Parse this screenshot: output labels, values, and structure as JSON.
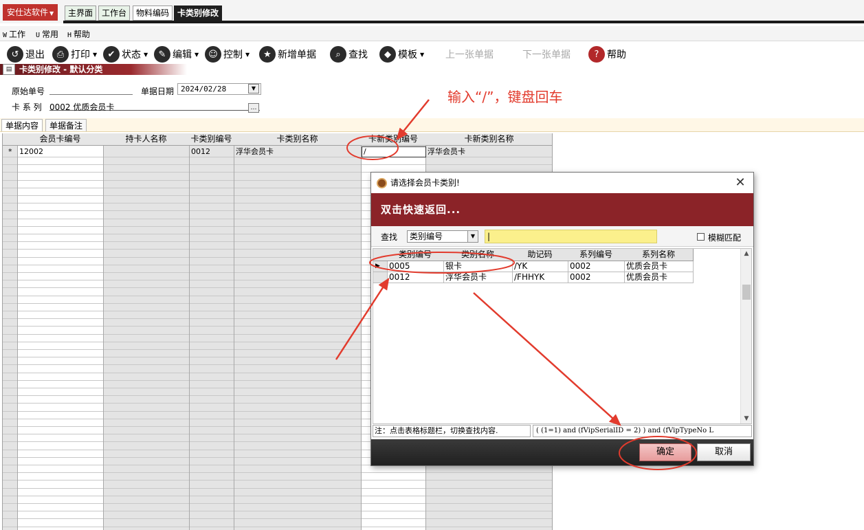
{
  "app": {
    "brand": "安仕达软件"
  },
  "tabs": [
    "主界面",
    "工作台",
    "物料编码",
    "卡类别修改"
  ],
  "menu": [
    {
      "key": "W",
      "label": "工作"
    },
    {
      "key": "U",
      "label": "常用"
    },
    {
      "key": "H",
      "label": "帮助"
    }
  ],
  "toolbar": {
    "exit": "退出",
    "print": "打印",
    "status": "状态",
    "edit": "编辑",
    "control": "控制",
    "new_doc": "新增单据",
    "find": "查找",
    "template": "模板",
    "prev": "上一张单据",
    "next": "下一张单据",
    "help": "帮助"
  },
  "form": {
    "title": "卡类别修改 - 默认分类",
    "orig_no_label": "原始单号",
    "orig_no_value": "",
    "date_label": "单据日期",
    "date_value": "2024/02/28",
    "series_label": "卡 系 列",
    "series_value": "0002 优质会员卡"
  },
  "annotation": "输入“/”，键盘回车",
  "page_tabs": [
    "单据内容",
    "单据备注"
  ],
  "grid": {
    "columns": [
      "会员卡编号",
      "持卡人名称",
      "卡类别编号",
      "卡类别名称",
      "卡新类别编号",
      "卡新类别名称"
    ],
    "rows": [
      {
        "marker": "*",
        "card_no": "12002",
        "holder": "",
        "type_no": "0012",
        "type_name": "浮华会员卡",
        "new_type_no": "/",
        "new_type_name": "浮华会员卡"
      }
    ]
  },
  "dialog": {
    "title": "请选择会员卡类别!",
    "banner": "双击快速返回...",
    "search_label": "查找",
    "search_field": "类别编号",
    "search_value": "|",
    "fuzzy_label": "模糊匹配",
    "columns": [
      "类别编号",
      "类别名称",
      "助记码",
      "系列编号",
      "系列名称"
    ],
    "rows": [
      {
        "code": "0005",
        "name": "银卡",
        "mnemonic": "/YK",
        "series_no": "0002",
        "series_name": "优质会员卡"
      },
      {
        "code": "0012",
        "name": "浮华会员卡",
        "mnemonic": "/FHHYK",
        "series_no": "0002",
        "series_name": "优质会员卡"
      }
    ],
    "note": "注：点击表格标题栏，切换查找内容.",
    "sql": "( (1=1)  and (fVipSerialID = 2) ) and (fVipTypeNo L",
    "ok": "确定",
    "cancel": "取消"
  },
  "colors": {
    "brand": "#c0322d",
    "banner": "#8b2328",
    "annotation": "#e23b2d"
  }
}
